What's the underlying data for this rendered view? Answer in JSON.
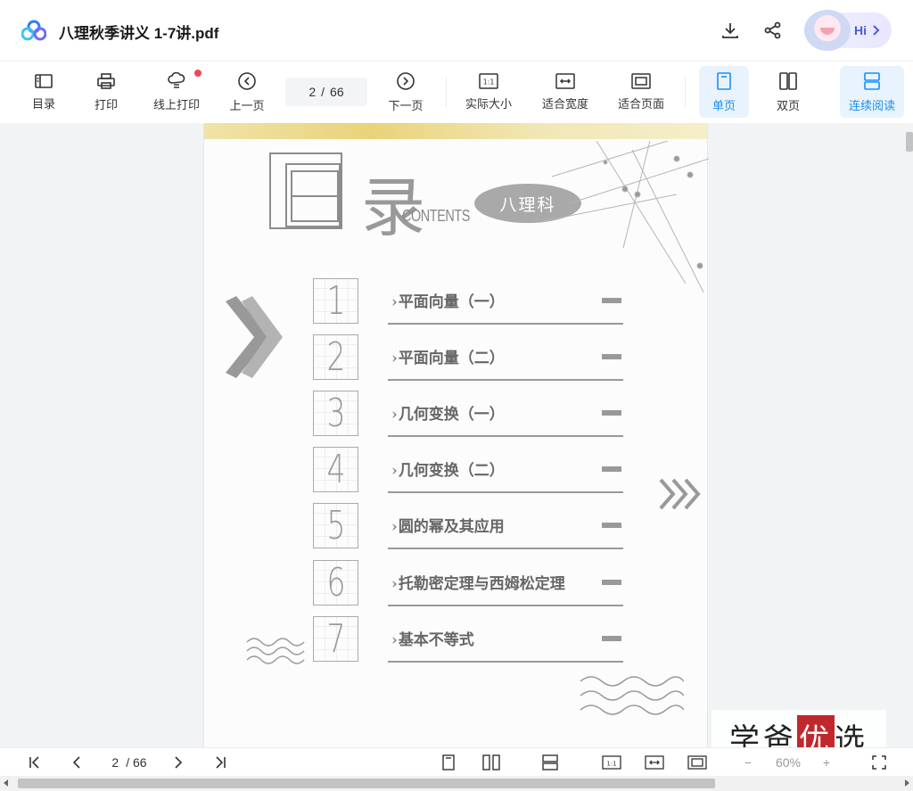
{
  "app": {
    "title": "八理秋季讲义 1-7讲.pdf",
    "hi_label": "Hi"
  },
  "toolbar": {
    "toc": "目录",
    "print": "打印",
    "online_print": "线上打印",
    "prev": "上一页",
    "page_current": "2",
    "page_total": "66",
    "page_sep": "/",
    "next": "下一页",
    "actual_size": "实际大小",
    "fit_width": "适合宽度",
    "fit_page": "适合页面",
    "single": "单页",
    "double": "双页",
    "continuous": "连续阅读"
  },
  "document": {
    "heading_cn": "目录",
    "heading_en": "CONTENTS",
    "subject": "八理科",
    "toc": [
      {
        "num": "1",
        "title": "平面向量（一）"
      },
      {
        "num": "2",
        "title": "平面向量（二）"
      },
      {
        "num": "3",
        "title": "几何变换（一）"
      },
      {
        "num": "4",
        "title": "几何变换（二）"
      },
      {
        "num": "5",
        "title": "圆的幂及其应用"
      },
      {
        "num": "6",
        "title": "托勒密定理与西姆松定理"
      },
      {
        "num": "7",
        "title": "基本不等式"
      }
    ]
  },
  "bottom": {
    "page_current": "2",
    "page_total": "/ 66",
    "zoom": "60%"
  },
  "watermark": {
    "pre": "学爸",
    "mid": "优",
    "post": "选"
  },
  "colors": {
    "accent": "#1a8ff0",
    "active_bg": "#e8f3fd"
  }
}
